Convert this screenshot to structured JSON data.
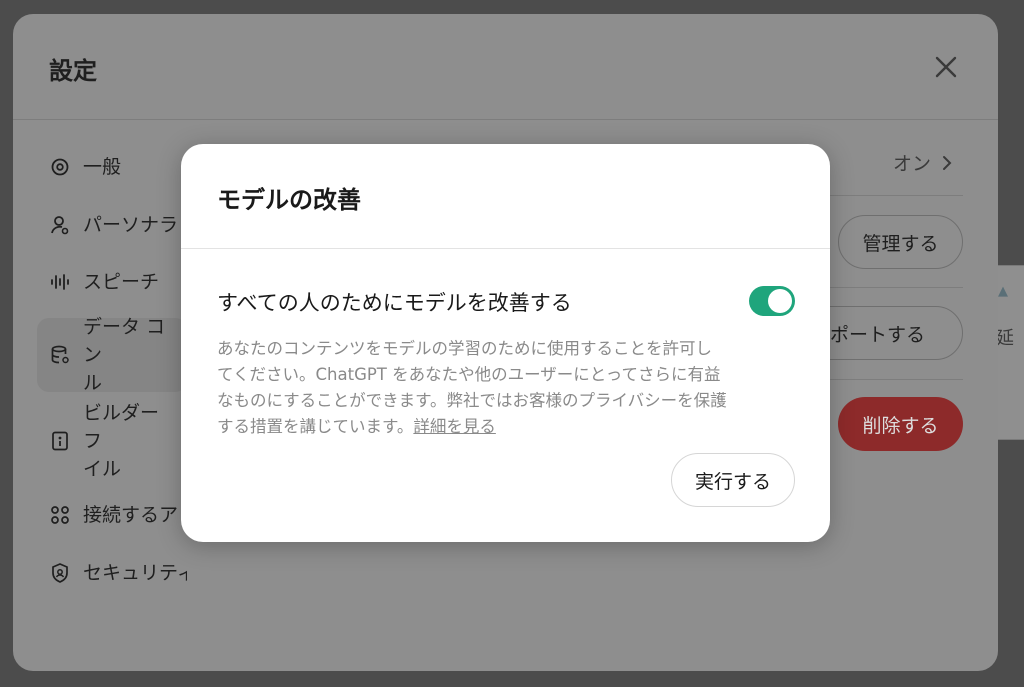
{
  "settings": {
    "title": "設定",
    "nav": [
      {
        "label": "一般",
        "icon": "gear-icon"
      },
      {
        "label": "パーソナラ",
        "icon": "person-icon"
      },
      {
        "label": "スピーチ",
        "icon": "waveform-icon"
      },
      {
        "label": "データ コン\nル",
        "icon": "database-icon"
      },
      {
        "label": "ビルダー フ\nイル",
        "icon": "id-card-icon"
      },
      {
        "label": "接続するア",
        "icon": "apps-icon"
      },
      {
        "label": "セキュリティ",
        "icon": "shield-icon"
      }
    ],
    "right": {
      "improve_status": "オン",
      "manage_label": "管理する",
      "export_label": "スポートする",
      "delete_label": "削除する"
    }
  },
  "background": {
    "peek_text": "延"
  },
  "modal": {
    "title": "モデルの改善",
    "toggle_label": "すべての人のためにモデルを改善する",
    "toggle_on": true,
    "description": "あなたのコンテンツをモデルの学習のために使用することを許可してください。ChatGPT をあなたや他のユーザーにとってさらに有益なものにすることができます。弊社ではお客様のプライバシーを保護する措置を講じています。",
    "learn_more": "詳細を見る",
    "run_label": "実行する"
  },
  "colors": {
    "toggle_on": "#1fa57c",
    "delete": "#8d2a2a"
  }
}
